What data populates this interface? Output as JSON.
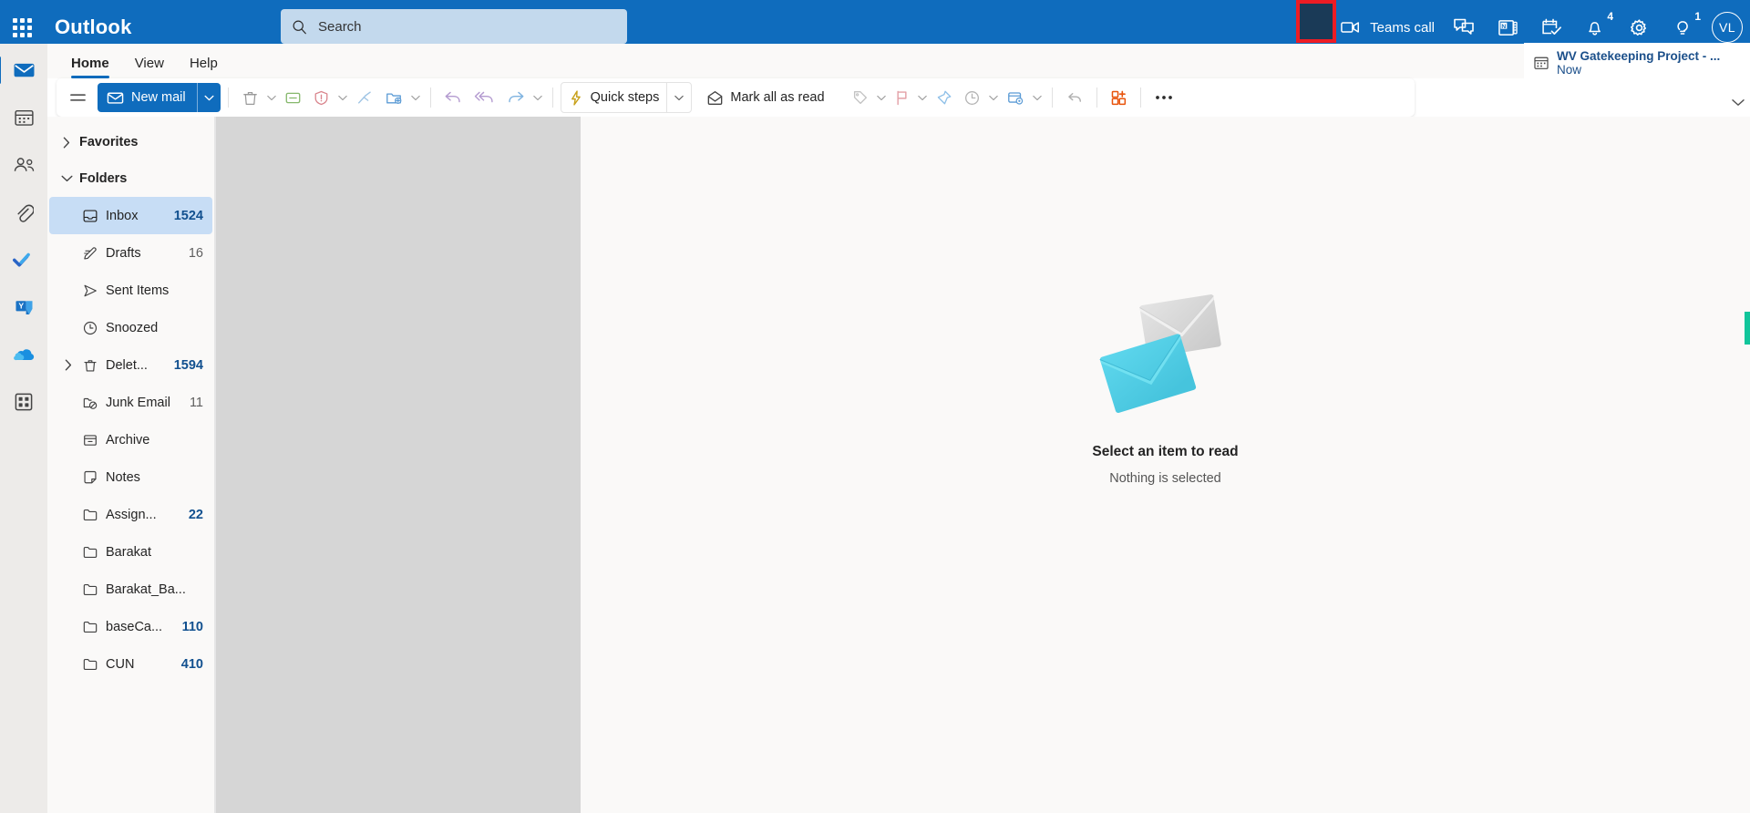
{
  "app": {
    "brand": "Outlook",
    "accent_blue": "#0F6CBD",
    "highlight_red": "#ED1C24"
  },
  "search": {
    "placeholder": "Search",
    "value": "",
    "icon": "search-icon"
  },
  "topbar_right": {
    "teams_call_label": "Teams call",
    "items": [
      {
        "name": "teams-call-icon",
        "label": "Teams call"
      },
      {
        "name": "chat-icon",
        "label": ""
      },
      {
        "name": "onenote-icon",
        "label": ""
      },
      {
        "name": "todo-icon",
        "label": ""
      },
      {
        "name": "notifications-bell-icon",
        "label": "",
        "badge": "4"
      },
      {
        "name": "settings-gear-icon",
        "label": ""
      },
      {
        "name": "tips-lightbulb-icon",
        "label": "",
        "badge": "1"
      }
    ],
    "notifications_badge": "4",
    "tips_badge": "1",
    "avatar_initials": "VL"
  },
  "notification_toast": {
    "icon": "calendar-event-icon",
    "title": "WV Gatekeeping Project - ...",
    "time": "Now"
  },
  "ribbon_tabs": [
    {
      "label": "Home",
      "active": true
    },
    {
      "label": "View",
      "active": false
    },
    {
      "label": "Help",
      "active": false
    }
  ],
  "toolbar": {
    "hamburger": "list-menu-icon",
    "new_mail_label": "New mail",
    "quick_steps_label": "Quick steps",
    "mark_all_read_label": "Mark all as read",
    "more_label": "...",
    "icons": [
      "delete-icon",
      "archive-icon",
      "report-icon",
      "sweep-icon",
      "move-to-icon",
      "reply-icon",
      "reply-all-icon",
      "forward-icon",
      "quick-steps-icon",
      "mark-all-read-icon",
      "tag-icon",
      "flag-icon",
      "pin-icon",
      "snooze-icon",
      "rules-icon",
      "undo-icon",
      "apps-icon",
      "more-options-icon"
    ]
  },
  "left_rail": [
    {
      "name": "mail-icon",
      "selected": true
    },
    {
      "name": "calendar-icon",
      "selected": false
    },
    {
      "name": "people-icon",
      "selected": false
    },
    {
      "name": "files-attachment-icon",
      "selected": false
    },
    {
      "name": "todo-check-icon",
      "selected": false
    },
    {
      "name": "yammer-viva-icon",
      "selected": false
    },
    {
      "name": "onedrive-cloud-icon",
      "selected": false
    },
    {
      "name": "apps-grid-icon",
      "selected": false
    }
  ],
  "folder_pane": {
    "groups": [
      {
        "label": "Favorites",
        "expanded": false
      },
      {
        "label": "Folders",
        "expanded": true
      }
    ],
    "folders": [
      {
        "label": "Inbox",
        "count": "1524",
        "icon": "inbox-icon",
        "selected": true,
        "expandable": false,
        "bold_count": true
      },
      {
        "label": "Drafts",
        "count": "16",
        "icon": "drafts-icon",
        "selected": false,
        "expandable": false,
        "bold_count": false
      },
      {
        "label": "Sent Items",
        "count": "",
        "icon": "sent-icon",
        "selected": false,
        "expandable": false,
        "bold_count": false
      },
      {
        "label": "Snoozed",
        "count": "",
        "icon": "snoozed-icon",
        "selected": false,
        "expandable": false,
        "bold_count": false
      },
      {
        "label": "Delet...",
        "count": "1594",
        "icon": "trash-icon",
        "selected": false,
        "expandable": true,
        "bold_count": true
      },
      {
        "label": "Junk Email",
        "count": "11",
        "icon": "junk-icon",
        "selected": false,
        "expandable": false,
        "bold_count": false
      },
      {
        "label": "Archive",
        "count": "",
        "icon": "archive-icon",
        "selected": false,
        "expandable": false,
        "bold_count": false
      },
      {
        "label": "Notes",
        "count": "",
        "icon": "notes-icon",
        "selected": false,
        "expandable": false,
        "bold_count": false
      },
      {
        "label": "Assign...",
        "count": "22",
        "icon": "folder-icon",
        "selected": false,
        "expandable": false,
        "bold_count": true
      },
      {
        "label": "Barakat",
        "count": "",
        "icon": "folder-icon",
        "selected": false,
        "expandable": false,
        "bold_count": false
      },
      {
        "label": "Barakat_Ba...",
        "count": "",
        "icon": "folder-icon",
        "selected": false,
        "expandable": false,
        "bold_count": false
      },
      {
        "label": "baseCa...",
        "count": "110",
        "icon": "folder-icon",
        "selected": false,
        "expandable": false,
        "bold_count": true
      },
      {
        "label": "CUN",
        "count": "410",
        "icon": "folder-icon",
        "selected": false,
        "expandable": false,
        "bold_count": true
      }
    ]
  },
  "reading_pane": {
    "title": "Select an item to read",
    "subtitle": "Nothing is selected",
    "illustration": "two-envelopes-illustration"
  }
}
